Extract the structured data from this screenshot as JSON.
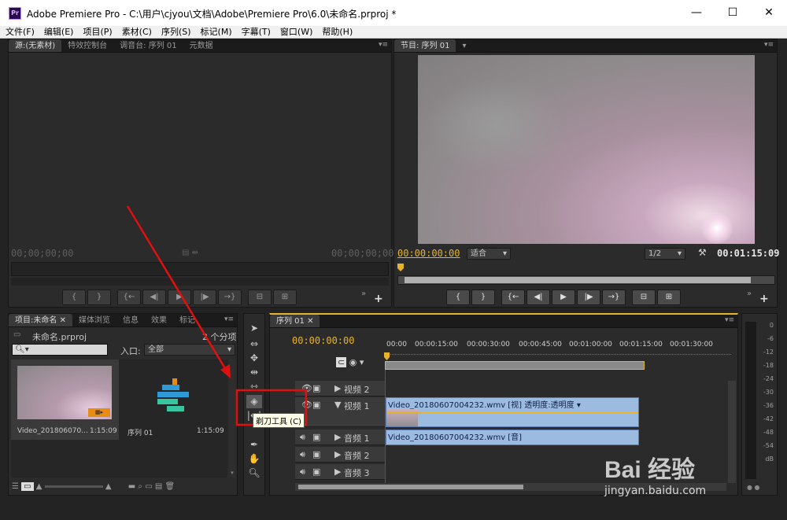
{
  "window": {
    "app_icon": "Pr",
    "title": "Adobe Premiere Pro - C:\\用户\\cjyou\\文档\\Adobe\\Premiere Pro\\6.0\\未命名.prproj *",
    "minimize": "—",
    "maximize": "☐",
    "close": "✕"
  },
  "menu": [
    "文件(F)",
    "编辑(E)",
    "项目(P)",
    "素材(C)",
    "序列(S)",
    "标记(M)",
    "字幕(T)",
    "窗口(W)",
    "帮助(H)"
  ],
  "source_panel": {
    "tabs": [
      "源:(无素材)",
      "特效控制台",
      "调音台: 序列 01",
      "元数据"
    ],
    "timecode_left": "00;00;00;00",
    "timecode_right": "00;00;00;00",
    "transport": [
      "{",
      "}",
      "{←",
      "◀|",
      "▶",
      "|▶",
      "→}",
      "⊟",
      "⊞"
    ]
  },
  "program_panel": {
    "tab": "节目: 序列 01",
    "timecode": "00:00:00:00",
    "fit": "适合",
    "resolution": "1/2",
    "duration": "00:01:15:09",
    "transport": [
      "{",
      "}",
      "{←",
      "◀|",
      "▶",
      "|▶",
      "→}",
      "⊟",
      "⊞"
    ],
    "wrench_icon": "🔧"
  },
  "project_panel": {
    "tabs": [
      "项目:未命名",
      "媒体浏览",
      "信息",
      "效果",
      "标记"
    ],
    "project_name": "未命名.prproj",
    "item_count": "2 个分项",
    "search_placeholder": "",
    "in_label": "入口:",
    "in_value": "全部",
    "items": [
      {
        "name": "Video_201806070...",
        "duration": "1:15:09"
      },
      {
        "name": "序列 01",
        "duration": "1:15:09"
      }
    ]
  },
  "tooltip": {
    "text": "剃刀工具 (C)"
  },
  "timeline": {
    "tab": "序列 01",
    "timecode": "00:00:00:00",
    "ruler": [
      "00:00",
      "00:00:15:00",
      "00:00:30:00",
      "00:00:45:00",
      "00:01:00:00",
      "00:01:15:00",
      "00:01:30:00"
    ],
    "tracks": [
      {
        "label": "视频 2"
      },
      {
        "label": "视频 1"
      },
      {
        "label": "音频 1"
      },
      {
        "label": "音频 2"
      },
      {
        "label": "音频 3"
      }
    ],
    "video_clip": "Video_20180607004232.wmv [视] 透明度:透明度 ▾",
    "audio_clip": "Video_20180607004232.wmv [音]"
  },
  "audio_meter": {
    "labels": [
      "0",
      "-6",
      "-12",
      "-18",
      "-24",
      "-30",
      "-36",
      "-42",
      "-48",
      "-54",
      "dB"
    ]
  },
  "watermark": {
    "brand": "Bai  经验",
    "url": "jingyan.baidu.com"
  },
  "colors": {
    "accent_gold": "#e7b32a",
    "clip_blue": "#9bbbe0",
    "annotation_red": "#e01010"
  }
}
